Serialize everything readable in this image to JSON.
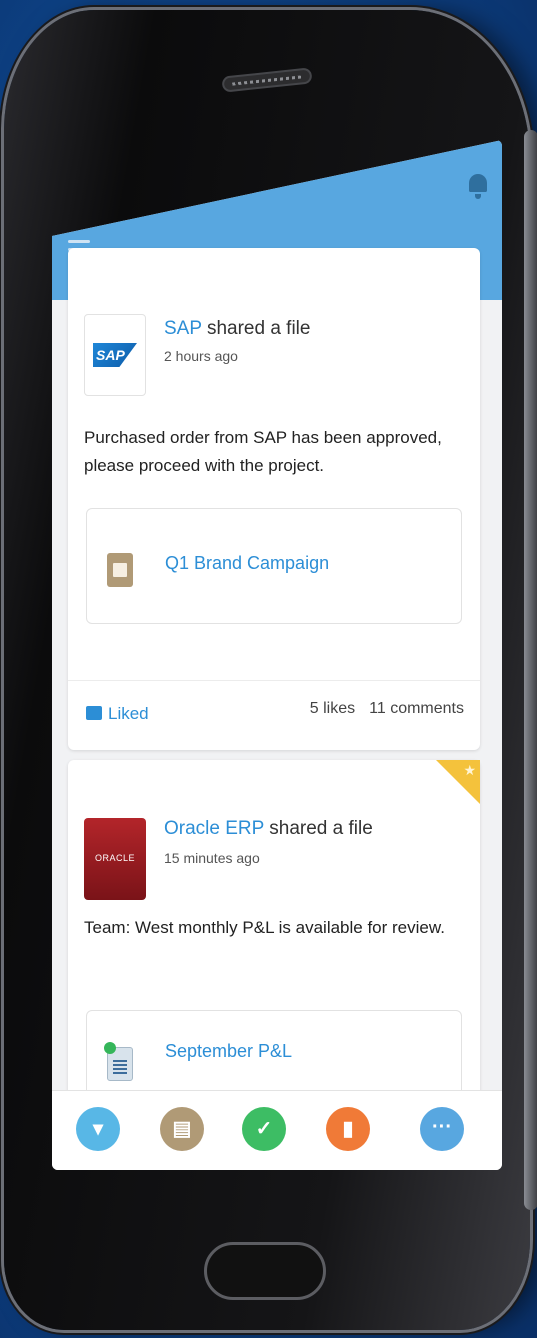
{
  "feed": [
    {
      "source": "SAP",
      "action": " shared a file",
      "time": "2 hours ago",
      "logo_text": "SAP",
      "message": "Purchased order from SAP has been approved, please proceed with the project.",
      "attachment": "Q1 Brand Campaign",
      "liked_label": "Liked",
      "likes": "5 likes",
      "comments": "11 comments"
    },
    {
      "source": "Oracle ERP",
      "action": " shared a file",
      "time": "15 minutes ago",
      "logo_text": "ORACLE",
      "message": "Team: West monthly P&L is available for review.",
      "attachment": "September P&L"
    }
  ],
  "bottom_nav": [
    {
      "icon": "chat-bubble-icon",
      "color": "#58b7e6"
    },
    {
      "icon": "document-icon",
      "color": "#b09a76"
    },
    {
      "icon": "check-icon",
      "color": "#3dbd64"
    },
    {
      "icon": "office-icon",
      "color": "#f07a37"
    },
    {
      "icon": "more-icon",
      "color": "#58a7e0"
    }
  ],
  "colors": {
    "topbar": "#58a7e0",
    "link": "#2c8ed6",
    "star_corner": "#f4c23c"
  }
}
